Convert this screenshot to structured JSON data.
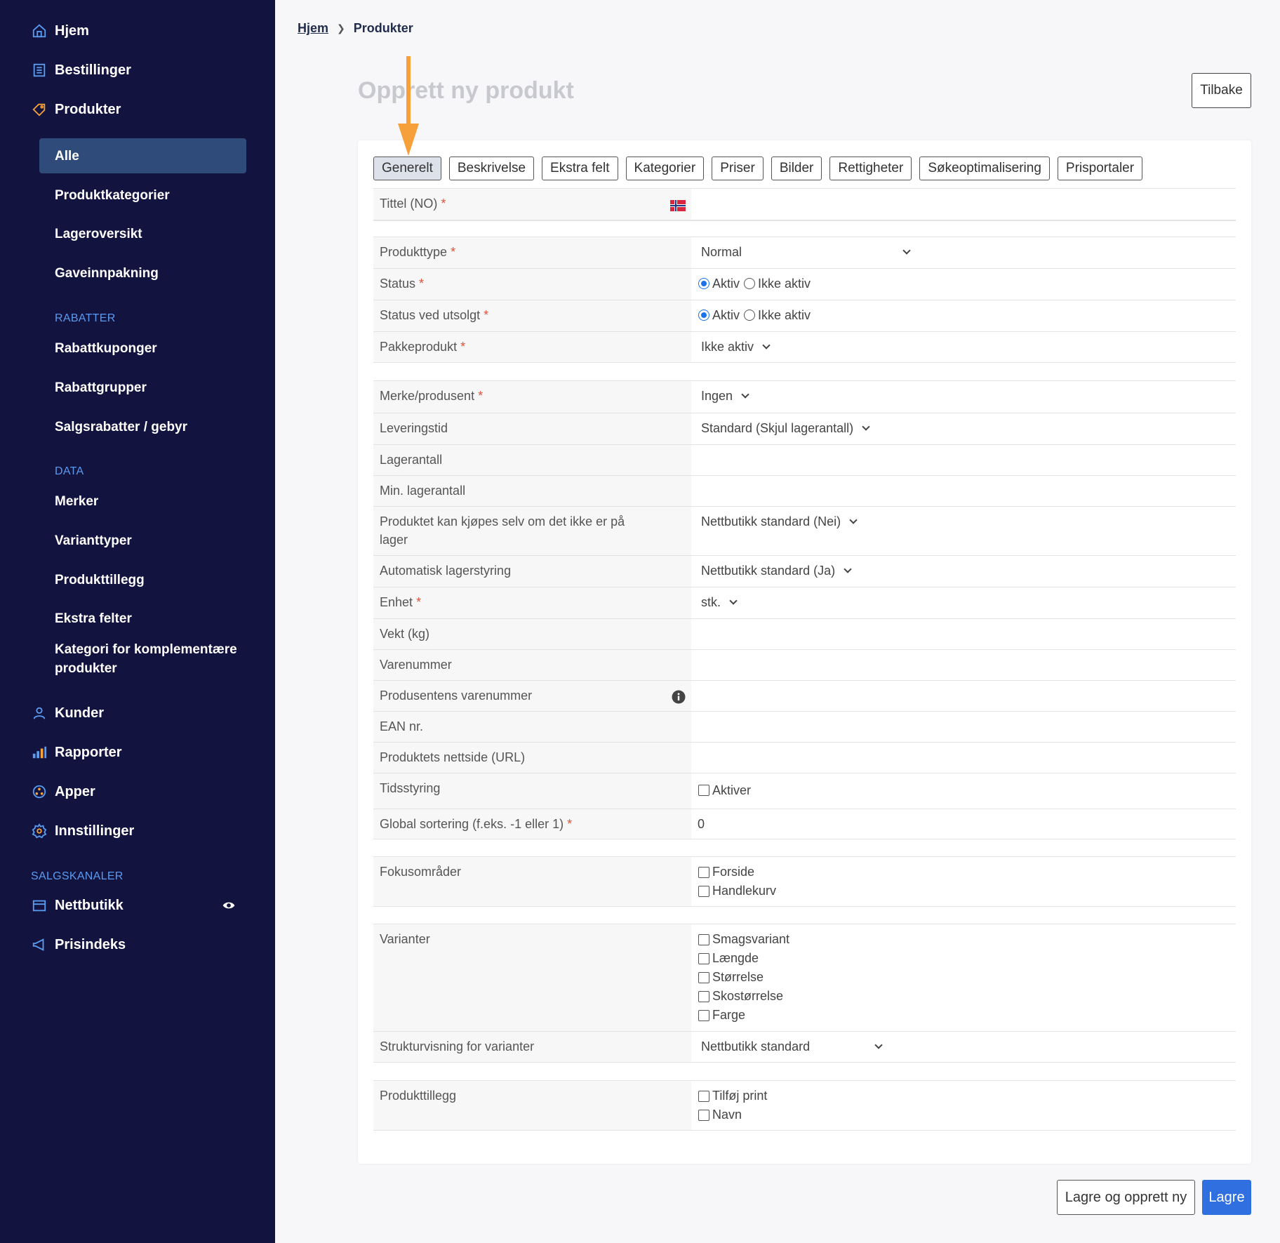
{
  "sidebar": {
    "items": [
      {
        "label": "Hjem",
        "icon": "home-icon"
      },
      {
        "label": "Bestillinger",
        "icon": "orders-icon"
      },
      {
        "label": "Produkter",
        "icon": "tag-icon"
      }
    ],
    "products_sub": [
      "Alle",
      "Produktkategorier",
      "Lageroversikt",
      "Gaveinnpakning"
    ],
    "rabatter_label": "RABATTER",
    "rabatter": [
      "Rabattkuponger",
      "Rabattgrupper",
      "Salgsrabatter / gebyr"
    ],
    "data_label": "DATA",
    "data": [
      "Merker",
      "Varianttyper",
      "Produkttillegg",
      "Ekstra felter",
      "Kategori for komplementære produkter"
    ],
    "lower": [
      {
        "label": "Kunder",
        "icon": "customer-icon"
      },
      {
        "label": "Rapporter",
        "icon": "bar-chart-icon"
      },
      {
        "label": "Apper",
        "icon": "apps-icon"
      },
      {
        "label": "Innstillinger",
        "icon": "gear-icon"
      }
    ],
    "salgskanaler_label": "SALGSKANALER",
    "channels": [
      {
        "label": "Nettbutikk",
        "icon": "store-icon"
      },
      {
        "label": "Prisindeks",
        "icon": "megaphone-icon"
      }
    ]
  },
  "breadcrumb": {
    "home": "Hjem",
    "current": "Produkter"
  },
  "page_title": "Opprett ny produkt",
  "back_button": "Tilbake",
  "tabs": [
    "Generelt",
    "Beskrivelse",
    "Ekstra felt",
    "Kategorier",
    "Priser",
    "Bilder",
    "Rettigheter",
    "Søkeoptimalisering",
    "Prisportaler"
  ],
  "form": {
    "title_label": "Tittel (NO)",
    "product_type_label": "Produkttype",
    "product_type_value": "Normal",
    "status_label": "Status",
    "status_soldout_label": "Status ved utsolgt",
    "radio_on": "Aktiv",
    "radio_off": "Ikke aktiv",
    "package_label": "Pakkeprodukt",
    "package_value": "Ikke aktiv",
    "brand_label": "Merke/produsent",
    "brand_value": "Ingen",
    "delivery_label": "Leveringstid",
    "delivery_value": "Standard (Skjul lagerantall)",
    "stock_label": "Lagerantall",
    "min_stock_label": "Min. lagerantall",
    "buy_oos_label": "Produktet kan kjøpes selv om det ikke er på lager",
    "buy_oos_value": "Nettbutikk standard (Nei)",
    "auto_stock_label": "Automatisk lagerstyring",
    "auto_stock_value": "Nettbutikk standard (Ja)",
    "unit_label": "Enhet",
    "unit_value": "stk.",
    "weight_label": "Vekt (kg)",
    "sku_label": "Varenummer",
    "mfr_sku_label": "Produsentens varenummer",
    "ean_label": "EAN nr.",
    "url_label": "Produktets nettside (URL)",
    "timing_label": "Tidsstyring",
    "timing_value": "Aktiver",
    "sort_label": "Global sortering (f.eks. -1 eller 1)",
    "sort_value": "0",
    "focus_label": "Fokusområder",
    "focus_options": [
      "Forside",
      "Handlekurv"
    ],
    "variants_label": "Varianter",
    "variant_options": [
      "Smagsvariant",
      "Længde",
      "Størrelse",
      "Skostørrelse",
      "Farge"
    ],
    "structure_label": "Strukturvisning for varianter",
    "structure_value": "Nettbutikk standard",
    "addons_label": "Produkttillegg",
    "addon_options": [
      "Tilføj print",
      "Navn"
    ]
  },
  "buttons": {
    "save_new": "Lagre og opprett ny",
    "save": "Lagre"
  },
  "colors": {
    "sidebar_bg": "#12133f",
    "accent": "#2f6fe0",
    "annotation_arrow": "#f5a03a",
    "required": "#e0533a"
  }
}
